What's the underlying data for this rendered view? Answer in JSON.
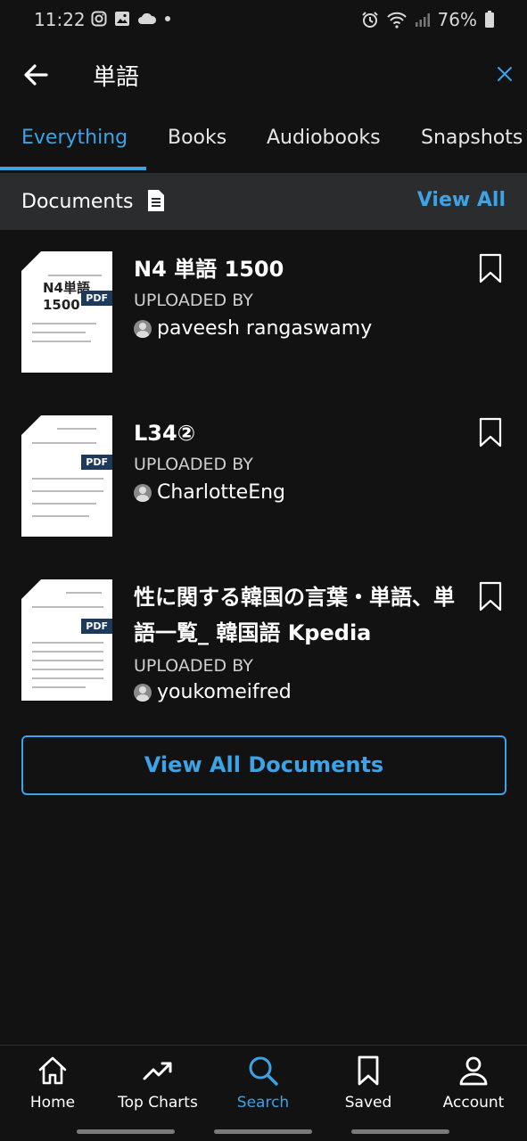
{
  "status_bar": {
    "time": "11:22",
    "battery": "76%",
    "left_icons": [
      "instagram-icon",
      "gallery-icon",
      "cloud-icon",
      "dot-icon"
    ],
    "right_icons": [
      "alarm-icon",
      "wifi-icon",
      "signal-icon",
      "battery-icon"
    ]
  },
  "search": {
    "query": "単語",
    "back_icon": "back-arrow-icon",
    "clear_icon": "close-icon"
  },
  "tabs": [
    {
      "label": "Everything",
      "active": true
    },
    {
      "label": "Books",
      "active": false
    },
    {
      "label": "Audiobooks",
      "active": false
    },
    {
      "label": "Snapshots",
      "active": false
    }
  ],
  "section": {
    "title": "Documents",
    "icon": "document-icon",
    "view_all": "View All"
  },
  "documents": [
    {
      "title": "N4 単語 1500",
      "uploaded_label": "UPLOADED BY",
      "uploader": "paveesh rangaswamy",
      "badge": "PDF",
      "thumb_text": "N4単語 1500"
    },
    {
      "title": "L34②",
      "uploaded_label": "UPLOADED BY",
      "uploader": "CharlotteEng",
      "badge": "PDF"
    },
    {
      "title": "性に関する韓国の言葉・単語、単語一覧_ 韓国語 Kpedia",
      "uploaded_label": "UPLOADED BY",
      "uploader": "youkomeifred",
      "badge": "PDF"
    }
  ],
  "view_all_documents": "View All Documents",
  "bottom_nav": [
    {
      "label": "Home",
      "icon": "home-icon",
      "active": false
    },
    {
      "label": "Top Charts",
      "icon": "trending-icon",
      "active": false
    },
    {
      "label": "Search",
      "icon": "search-icon",
      "active": true
    },
    {
      "label": "Saved",
      "icon": "bookmark-icon",
      "active": false
    },
    {
      "label": "Account",
      "icon": "account-icon",
      "active": false
    }
  ],
  "colors": {
    "accent": "#3ca3e6",
    "background": "#121212",
    "section_bg": "#2b2c2e"
  }
}
